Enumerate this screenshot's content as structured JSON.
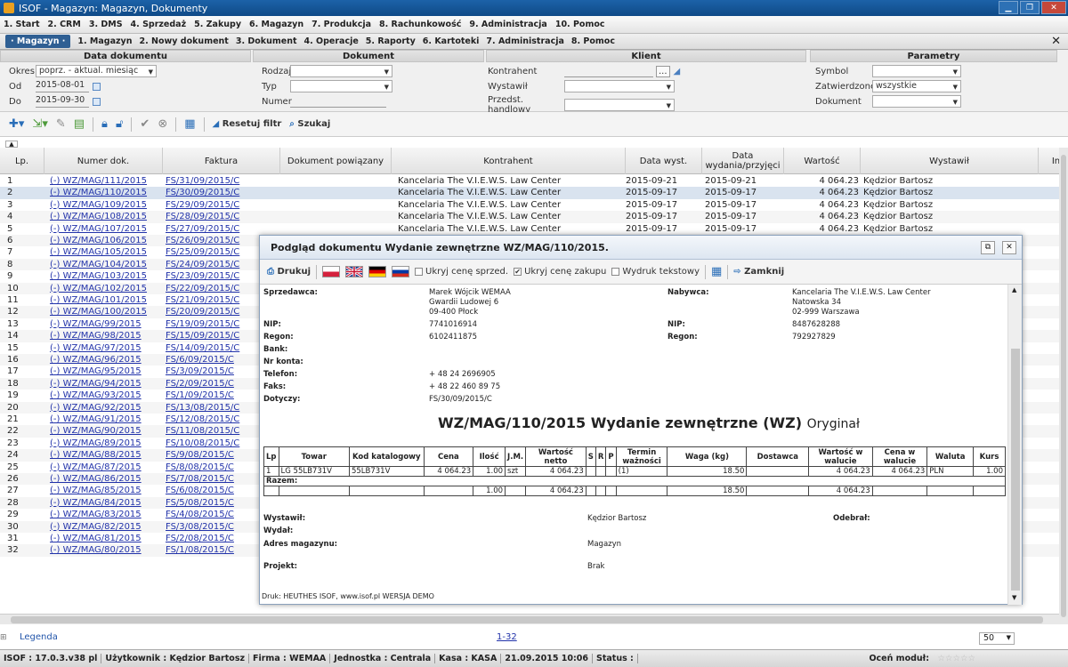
{
  "window": {
    "title": "ISOF - Magazyn: Magazyn, Dokumenty"
  },
  "menu_main": [
    "1. Start",
    "2. CRM",
    "3. DMS",
    "4. Sprzedaż",
    "5. Zakupy",
    "6. Magazyn",
    "7. Produkcja",
    "8. Rachunkowość",
    "9. Administracja",
    "10. Pomoc"
  ],
  "menu_sub": {
    "active": "· Magazyn ·",
    "items": [
      "1. Magazyn",
      "2. Nowy dokument",
      "3. Dokument",
      "4. Operacje",
      "5. Raporty",
      "6. Kartoteki",
      "7. Administracja",
      "8. Pomoc"
    ]
  },
  "filters": {
    "data_dok": {
      "title": "Data dokumentu",
      "okres_label": "Okres",
      "okres_value": "poprz. - aktual. miesiąc",
      "od_label": "Od",
      "od_value": "2015-08-01",
      "do_label": "Do",
      "do_value": "2015-09-30"
    },
    "dokument": {
      "title": "Dokument",
      "rodzaj_label": "Rodzaj",
      "typ_label": "Typ",
      "numer_label": "Numer"
    },
    "klient": {
      "title": "Klient",
      "kontrahent_label": "Kontrahent",
      "browse": "...",
      "wystawil_label": "Wystawił",
      "przedst_label": "Przedst. handlowy"
    },
    "parametry": {
      "title": "Parametry",
      "symbol_label": "Symbol",
      "zatw_label": "Zatwierdzone",
      "zatw_value": "wszystkie",
      "dokument_label": "Dokument"
    }
  },
  "toolbar": {
    "reset_label": "Resetuj filtr",
    "search_label": "Szukaj"
  },
  "grid": {
    "headers": [
      "Lp.",
      "Numer dok.",
      "Faktura",
      "Dokument powiązany",
      "Kontrahent",
      "Data wyst.",
      "Data wydania/przyjęci",
      "Wartość",
      "Wystawił",
      "In"
    ],
    "rows": [
      [
        "1",
        "(-) WZ/MAG/111/2015",
        "FS/31/09/2015/C",
        "Kancelaria The V.I.E.W.S. Law Center",
        "2015-09-21",
        "2015-09-21",
        "4 064.23",
        "Kędzior Bartosz"
      ],
      [
        "2",
        "(-) WZ/MAG/110/2015",
        "FS/30/09/2015/C",
        "Kancelaria The V.I.E.W.S. Law Center",
        "2015-09-17",
        "2015-09-17",
        "4 064.23",
        "Kędzior Bartosz"
      ],
      [
        "3",
        "(-) WZ/MAG/109/2015",
        "FS/29/09/2015/C",
        "Kancelaria The V.I.E.W.S. Law Center",
        "2015-09-17",
        "2015-09-17",
        "4 064.23",
        "Kędzior Bartosz"
      ],
      [
        "4",
        "(-) WZ/MAG/108/2015",
        "FS/28/09/2015/C",
        "Kancelaria The V.I.E.W.S. Law Center",
        "2015-09-17",
        "2015-09-17",
        "4 064.23",
        "Kędzior Bartosz"
      ],
      [
        "5",
        "(-) WZ/MAG/107/2015",
        "FS/27/09/2015/C",
        "Kancelaria The V.I.E.W.S. Law Center",
        "2015-09-17",
        "2015-09-17",
        "4 064.23",
        "Kędzior Bartosz"
      ],
      [
        "6",
        "(-) WZ/MAG/106/2015",
        "FS/26/09/2015/C",
        "",
        "",
        "",
        "",
        ""
      ],
      [
        "7",
        "(-) WZ/MAG/105/2015",
        "FS/25/09/2015/C",
        "",
        "",
        "",
        "",
        ""
      ],
      [
        "8",
        "(-) WZ/MAG/104/2015",
        "FS/24/09/2015/C",
        "",
        "",
        "",
        "",
        ""
      ],
      [
        "9",
        "(-) WZ/MAG/103/2015",
        "FS/23/09/2015/C",
        "",
        "",
        "",
        "",
        ""
      ],
      [
        "10",
        "(-) WZ/MAG/102/2015",
        "FS/22/09/2015/C",
        "",
        "",
        "",
        "",
        ""
      ],
      [
        "11",
        "(-) WZ/MAG/101/2015",
        "FS/21/09/2015/C",
        "",
        "",
        "",
        "",
        ""
      ],
      [
        "12",
        "(-) WZ/MAG/100/2015",
        "FS/20/09/2015/C",
        "",
        "",
        "",
        "",
        ""
      ],
      [
        "13",
        "(-) WZ/MAG/99/2015",
        "FS/19/09/2015/C",
        "",
        "",
        "",
        "",
        ""
      ],
      [
        "14",
        "(-) WZ/MAG/98/2015",
        "FS/15/09/2015/C",
        "",
        "",
        "",
        "",
        ""
      ],
      [
        "15",
        "(-) WZ/MAG/97/2015",
        "FS/14/09/2015/C",
        "",
        "",
        "",
        "",
        ""
      ],
      [
        "16",
        "(-) WZ/MAG/96/2015",
        "FS/6/09/2015/C",
        "",
        "",
        "",
        "",
        ""
      ],
      [
        "17",
        "(-) WZ/MAG/95/2015",
        "FS/3/09/2015/C",
        "",
        "",
        "",
        "",
        ""
      ],
      [
        "18",
        "(-) WZ/MAG/94/2015",
        "FS/2/09/2015/C",
        "",
        "",
        "",
        "",
        ""
      ],
      [
        "19",
        "(-) WZ/MAG/93/2015",
        "FS/1/09/2015/C",
        "",
        "",
        "",
        "",
        ""
      ],
      [
        "20",
        "(-) WZ/MAG/92/2015",
        "FS/13/08/2015/C",
        "",
        "",
        "",
        "",
        ""
      ],
      [
        "21",
        "(-) WZ/MAG/91/2015",
        "FS/12/08/2015/C",
        "",
        "",
        "",
        "",
        ""
      ],
      [
        "22",
        "(-) WZ/MAG/90/2015",
        "FS/11/08/2015/C",
        "",
        "",
        "",
        "",
        ""
      ],
      [
        "23",
        "(-) WZ/MAG/89/2015",
        "FS/10/08/2015/C",
        "",
        "",
        "",
        "",
        ""
      ],
      [
        "24",
        "(-) WZ/MAG/88/2015",
        "FS/9/08/2015/C",
        "",
        "",
        "",
        "",
        ""
      ],
      [
        "25",
        "(-) WZ/MAG/87/2015",
        "FS/8/08/2015/C",
        "",
        "",
        "",
        "",
        ""
      ],
      [
        "26",
        "(-) WZ/MAG/86/2015",
        "FS/7/08/2015/C",
        "",
        "",
        "",
        "",
        ""
      ],
      [
        "27",
        "(-) WZ/MAG/85/2015",
        "FS/6/08/2015/C",
        "",
        "",
        "",
        "",
        ""
      ],
      [
        "28",
        "(-) WZ/MAG/84/2015",
        "FS/5/08/2015/C",
        "",
        "",
        "",
        "",
        ""
      ],
      [
        "29",
        "(-) WZ/MAG/83/2015",
        "FS/4/08/2015/C",
        "",
        "",
        "",
        "",
        ""
      ],
      [
        "30",
        "(-) WZ/MAG/82/2015",
        "FS/3/08/2015/C",
        "",
        "",
        "",
        "",
        ""
      ],
      [
        "31",
        "(-) WZ/MAG/81/2015",
        "FS/2/08/2015/C",
        "",
        "",
        "",
        "",
        ""
      ],
      [
        "32",
        "(-) WZ/MAG/80/2015",
        "FS/1/08/2015/C",
        "",
        "",
        "",
        "",
        ""
      ]
    ]
  },
  "bottom": {
    "legenda": "Legenda",
    "pager": "1-32",
    "page_size": "50"
  },
  "status": {
    "version": "ISOF : 17.0.3.v38 pl",
    "user": "Użytkownik : Kędzior Bartosz",
    "firma": "Firma : WEMAA",
    "jednostka": "Jednostka : Centrala",
    "kasa": "Kasa : KASA",
    "datetime": "21.09.2015 10:06",
    "status": "Status :",
    "rate": "Oceń moduł:"
  },
  "modal": {
    "title": "Podgląd dokumentu Wydanie zewnętrzne WZ/MAG/110/2015.",
    "print": "Drukuj",
    "opt1": "Ukryj cenę sprzed.",
    "opt2": "Ukryj cenę zakupu",
    "opt3": "Wydruk tekstowy",
    "close": "Zamknij",
    "seller_label": "Sprzedawca:",
    "seller": [
      "Marek Wójcik WEMAA",
      "Gwardii Ludowej 6",
      "09-400 Płock"
    ],
    "buyer_label": "Nabywca:",
    "buyer": [
      "Kancelaria The V.I.E.W.S. Law Center",
      "Natowska 34",
      "02-999 Warszawa"
    ],
    "nip_label": "NIP:",
    "nip": "7741016914",
    "buyer_nip": "8487628288",
    "regon_label": "Regon:",
    "regon": "6102411875",
    "buyer_regon": "792927829",
    "bank_label": "Bank:",
    "konto_label": "Nr konta:",
    "tel_label": "Telefon:",
    "tel": "+ 48 24 2696905",
    "fax_label": "Faks:",
    "fax": "+ 48 22 460 89 75",
    "dotyczy_label": "Dotyczy:",
    "dotyczy": "FS/30/09/2015/C",
    "doc_title": "WZ/MAG/110/2015 Wydanie zewnętrzne (WZ)",
    "doc_sub": "Oryginał",
    "table_headers": [
      "Lp",
      "Towar",
      "Kod katalogowy",
      "Cena",
      "Ilość",
      "J.M.",
      "Wartość netto",
      "S",
      "R",
      "P",
      "Termin ważności",
      "Waga (kg)",
      "Dostawca",
      "Wartość w walucie",
      "Cena w walucie",
      "Waluta",
      "Kurs"
    ],
    "row": [
      "1",
      "LG 55LB731V",
      "55LB731V",
      "4 064.23",
      "1.00",
      "szt",
      "4 064.23",
      "",
      "",
      "",
      "(1)",
      "18.50",
      "",
      "4 064.23",
      "4 064.23",
      "PLN",
      "1.00"
    ],
    "razem_label": "Razem:",
    "totals": {
      "ilosc": "1.00",
      "netto": "4 064.23",
      "waga": "18.50",
      "waluta": "4 064.23"
    },
    "wystawil_label": "Wystawił:",
    "wystawil": "Kędzior Bartosz",
    "odebral_label": "Odebrał:",
    "wydal_label": "Wydał:",
    "adres_label": "Adres magazynu:",
    "adres": "Magazyn",
    "projekt_label": "Projekt:",
    "projekt": "Brak",
    "footer": "Druk: HEUTHES ISOF, www.isof.pl WERSJA DEMO"
  }
}
